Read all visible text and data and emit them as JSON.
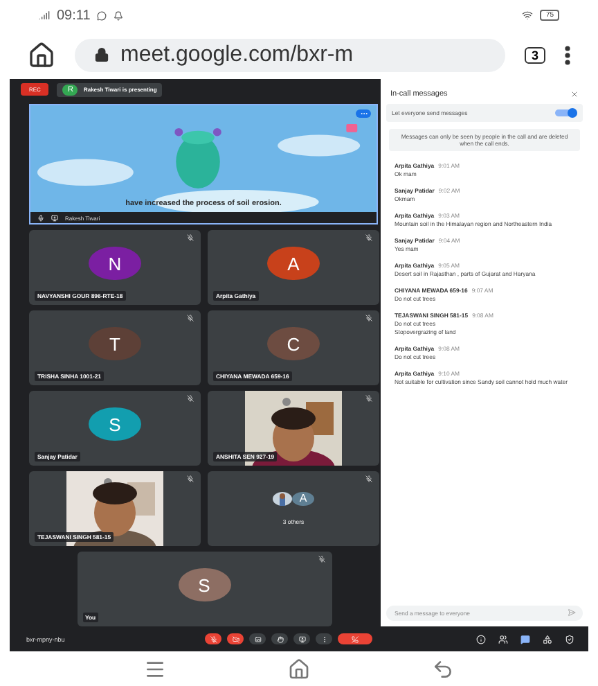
{
  "status_bar": {
    "time": "09:11",
    "battery": "75"
  },
  "browser": {
    "url": "meet.google.com/bxr-m",
    "tab_count": "3"
  },
  "meet": {
    "rec": "REC",
    "presenter": {
      "initial": "R",
      "text": "Rakesh Tiwari is presenting"
    },
    "presentation": {
      "caption": "have increased the process of soil erosion.",
      "name": "Rakesh Tiwari"
    },
    "tiles": [
      {
        "kind": "avatar",
        "name": "NAVYANSHI GOUR 896-RTE-18",
        "initial": "N",
        "color": "#7b1fa2",
        "muted": true
      },
      {
        "kind": "avatar",
        "name": "Arpita Gathiya",
        "initial": "A",
        "color": "#c8411b",
        "muted": true
      },
      {
        "kind": "avatar",
        "name": "TRISHA SINHA 1001-21",
        "initial": "T",
        "color": "#5d4037",
        "muted": true
      },
      {
        "kind": "avatar",
        "name": "CHIYANA MEWADA 659-16",
        "initial": "C",
        "color": "#6d4c41",
        "muted": true
      },
      {
        "kind": "avatar",
        "name": "Sanjay Patidar",
        "initial": "S",
        "color": "#129eaf",
        "muted": true
      },
      {
        "name": "ANSHITA SEN 927-19",
        "muted": true
      },
      {
        "name": "TEJASWANI SINGH 581-15",
        "muted": true
      },
      {
        "kind": "others",
        "name": "3 others",
        "initial": "A",
        "color": "#5f7f93",
        "muted": true
      }
    ],
    "self_tile": {
      "name": "You",
      "initial": "S",
      "color": "#8d6e63",
      "muted": true
    },
    "meeting_code": "bxr-mpny-nbu",
    "controls": [
      {
        "kind": "mic",
        "on": false
      },
      {
        "kind": "camera",
        "on": false
      },
      {
        "kind": "captions"
      },
      {
        "kind": "hand"
      },
      {
        "kind": "present"
      },
      {
        "kind": "more"
      },
      {
        "kind": "hangup"
      }
    ],
    "tools": [
      {
        "kind": "info",
        "selected": false
      },
      {
        "kind": "people",
        "selected": false
      },
      {
        "kind": "chat",
        "selected": true
      },
      {
        "kind": "activities",
        "selected": false
      },
      {
        "kind": "safety",
        "selected": false
      }
    ]
  },
  "chat": {
    "title": "In-call messages",
    "setting": {
      "label": "Let everyone send messages",
      "on": true
    },
    "notice": "Messages can only be seen by people in the call and are deleted when the call ends.",
    "messages": [
      {
        "sender": "Arpita Gathiya",
        "time": "9:01 AM",
        "lines": [
          "Ok mam"
        ]
      },
      {
        "sender": "Sanjay Patidar",
        "time": "9:02 AM",
        "lines": [
          "Okmam"
        ]
      },
      {
        "sender": "Arpita Gathiya",
        "time": "9:03 AM",
        "lines": [
          "Mountain soil in the Himalayan region and Northeastern India"
        ]
      },
      {
        "sender": "Sanjay Patidar",
        "time": "9:04 AM",
        "lines": [
          "Yes mam"
        ]
      },
      {
        "sender": "Arpita Gathiya",
        "time": "9:05 AM",
        "lines": [
          "Desert soil in Rajasthan , parts of Gujarat and Haryana"
        ]
      },
      {
        "sender": "CHIYANA MEWADA 659-16",
        "time": "9:07 AM",
        "lines": [
          "Do not cut trees"
        ]
      },
      {
        "sender": "TEJASWANI SINGH 581-15",
        "time": "9:08 AM",
        "lines": [
          "Do not cut trees",
          "Stopovergrazing of land"
        ]
      },
      {
        "sender": "Arpita Gathiya",
        "time": "9:08 AM",
        "lines": [
          "Do not cut trees"
        ]
      },
      {
        "sender": "Arpita Gathiya",
        "time": "9:10 AM",
        "lines": [
          "Not suitable for cultivation since Sandy soil cannot hold much water"
        ]
      }
    ],
    "placeholder": "Send a message to everyone"
  }
}
